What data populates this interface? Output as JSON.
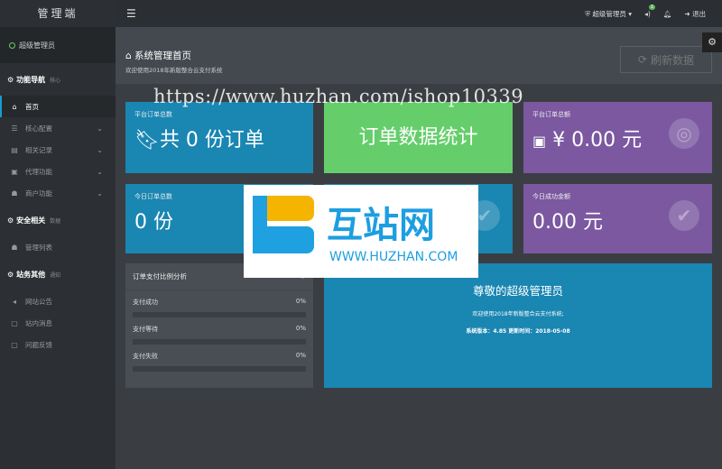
{
  "sidebar": {
    "brand": "管理端",
    "user": "超级管理员",
    "sections": [
      {
        "title": "功能导航",
        "tag": "核心",
        "items": [
          {
            "label": "首页",
            "icon": "home-icon",
            "active": true
          },
          {
            "label": "核心配置",
            "icon": "sliders-icon"
          },
          {
            "label": "相关记录",
            "icon": "list-icon"
          },
          {
            "label": "代理功能",
            "icon": "agent-icon"
          },
          {
            "label": "商户功能",
            "icon": "user-icon"
          }
        ]
      },
      {
        "title": "安全相关",
        "tag": "数据",
        "items": [
          {
            "label": "管理列表",
            "icon": "user-icon"
          }
        ]
      },
      {
        "title": "站务其他",
        "tag": "通知",
        "items": [
          {
            "label": "网站公告",
            "icon": "volume-icon"
          },
          {
            "label": "站内消息",
            "icon": "message-icon"
          },
          {
            "label": "问题反馈",
            "icon": "feedback-icon"
          }
        ]
      }
    ]
  },
  "topbar": {
    "user": "超级管理员",
    "notify_count": "1",
    "logout": "退出"
  },
  "header": {
    "title": "系统管理首页",
    "subtitle": "欢迎使用2018年新版整合云支付系统",
    "refresh": "刷新数据"
  },
  "cards": {
    "total_orders": {
      "label": "平台订单总数",
      "value": "共 0 份订单"
    },
    "stats": {
      "value": "订单数据统计"
    },
    "total_amount": {
      "label": "平台订单总额",
      "value": "¥  0.00 元"
    },
    "today_orders": {
      "label": "今日订单总数",
      "value": "0 份"
    },
    "today_amount": {
      "label": "今日成功金额",
      "value": "0.00 元"
    }
  },
  "analysis": {
    "title": "订单支付比例分析",
    "rows": [
      {
        "label": "支付成功",
        "pct": "0%",
        "value": 0
      },
      {
        "label": "支付等待",
        "pct": "0%",
        "value": 0
      },
      {
        "label": "支付失败",
        "pct": "0%",
        "value": 0
      }
    ]
  },
  "welcome": {
    "title": "尊敬的超级管理员",
    "line1": "欢迎使用2018年新版整合云支付系统;",
    "line2": "系统版本：4.85 更新时间：2018-05-08"
  },
  "watermark": {
    "url": "https://www.huzhan.com/ishop10339",
    "logo_text": "互站网",
    "logo_url": "WWW.HUZHAN.COM"
  }
}
